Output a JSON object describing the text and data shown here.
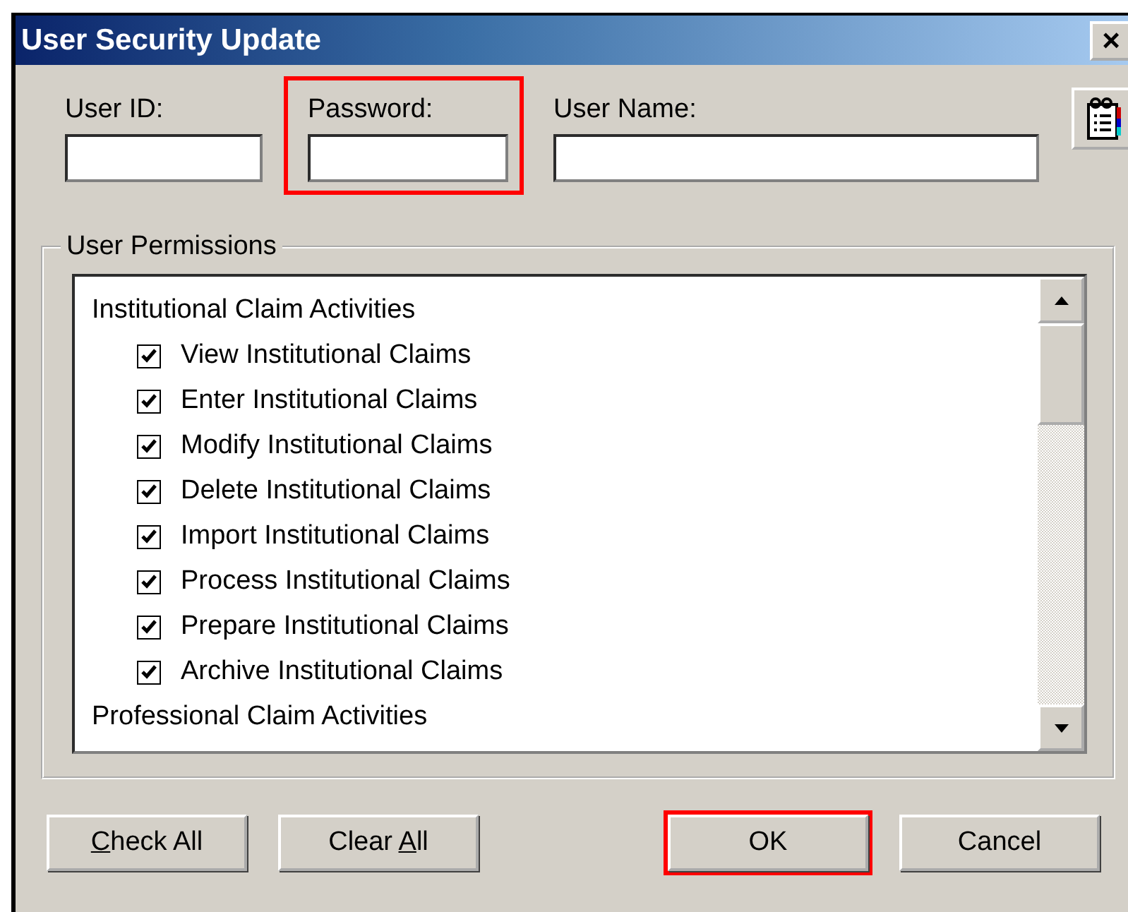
{
  "window": {
    "title": "User Security Update",
    "close": "×"
  },
  "fields": [
    {
      "label": "User ID:",
      "highlighted": false
    },
    {
      "label": "Password:",
      "highlighted": true
    },
    {
      "label": "User Name:",
      "highlighted": false
    }
  ],
  "permissions": {
    "title": "User Permissions",
    "items": [
      {
        "kind": "header",
        "label": "Institutional Claim Activities"
      },
      {
        "kind": "check",
        "label": "View Institutional Claims",
        "checked": true
      },
      {
        "kind": "check",
        "label": "Enter Institutional Claims",
        "checked": true
      },
      {
        "kind": "check",
        "label": "Modify Institutional Claims",
        "checked": true
      },
      {
        "kind": "check",
        "label": "Delete Institutional Claims",
        "checked": true
      },
      {
        "kind": "check",
        "label": "Import Institutional Claims",
        "checked": true
      },
      {
        "kind": "check",
        "label": "Process Institutional Claims",
        "checked": true
      },
      {
        "kind": "check",
        "label": "Prepare Institutional Claims",
        "checked": true
      },
      {
        "kind": "check",
        "label": "Archive Institutional Claims",
        "checked": true
      },
      {
        "kind": "header",
        "label": "Professional Claim Activities"
      }
    ]
  },
  "buttons": [
    {
      "key": "C",
      "after": "heck All",
      "highlighted": false
    },
    {
      "before": "Clear ",
      "key": "A",
      "after": "ll",
      "highlighted": false
    },
    {
      "before": "OK",
      "highlighted": true
    },
    {
      "before": "Cancel",
      "highlighted": false
    }
  ]
}
